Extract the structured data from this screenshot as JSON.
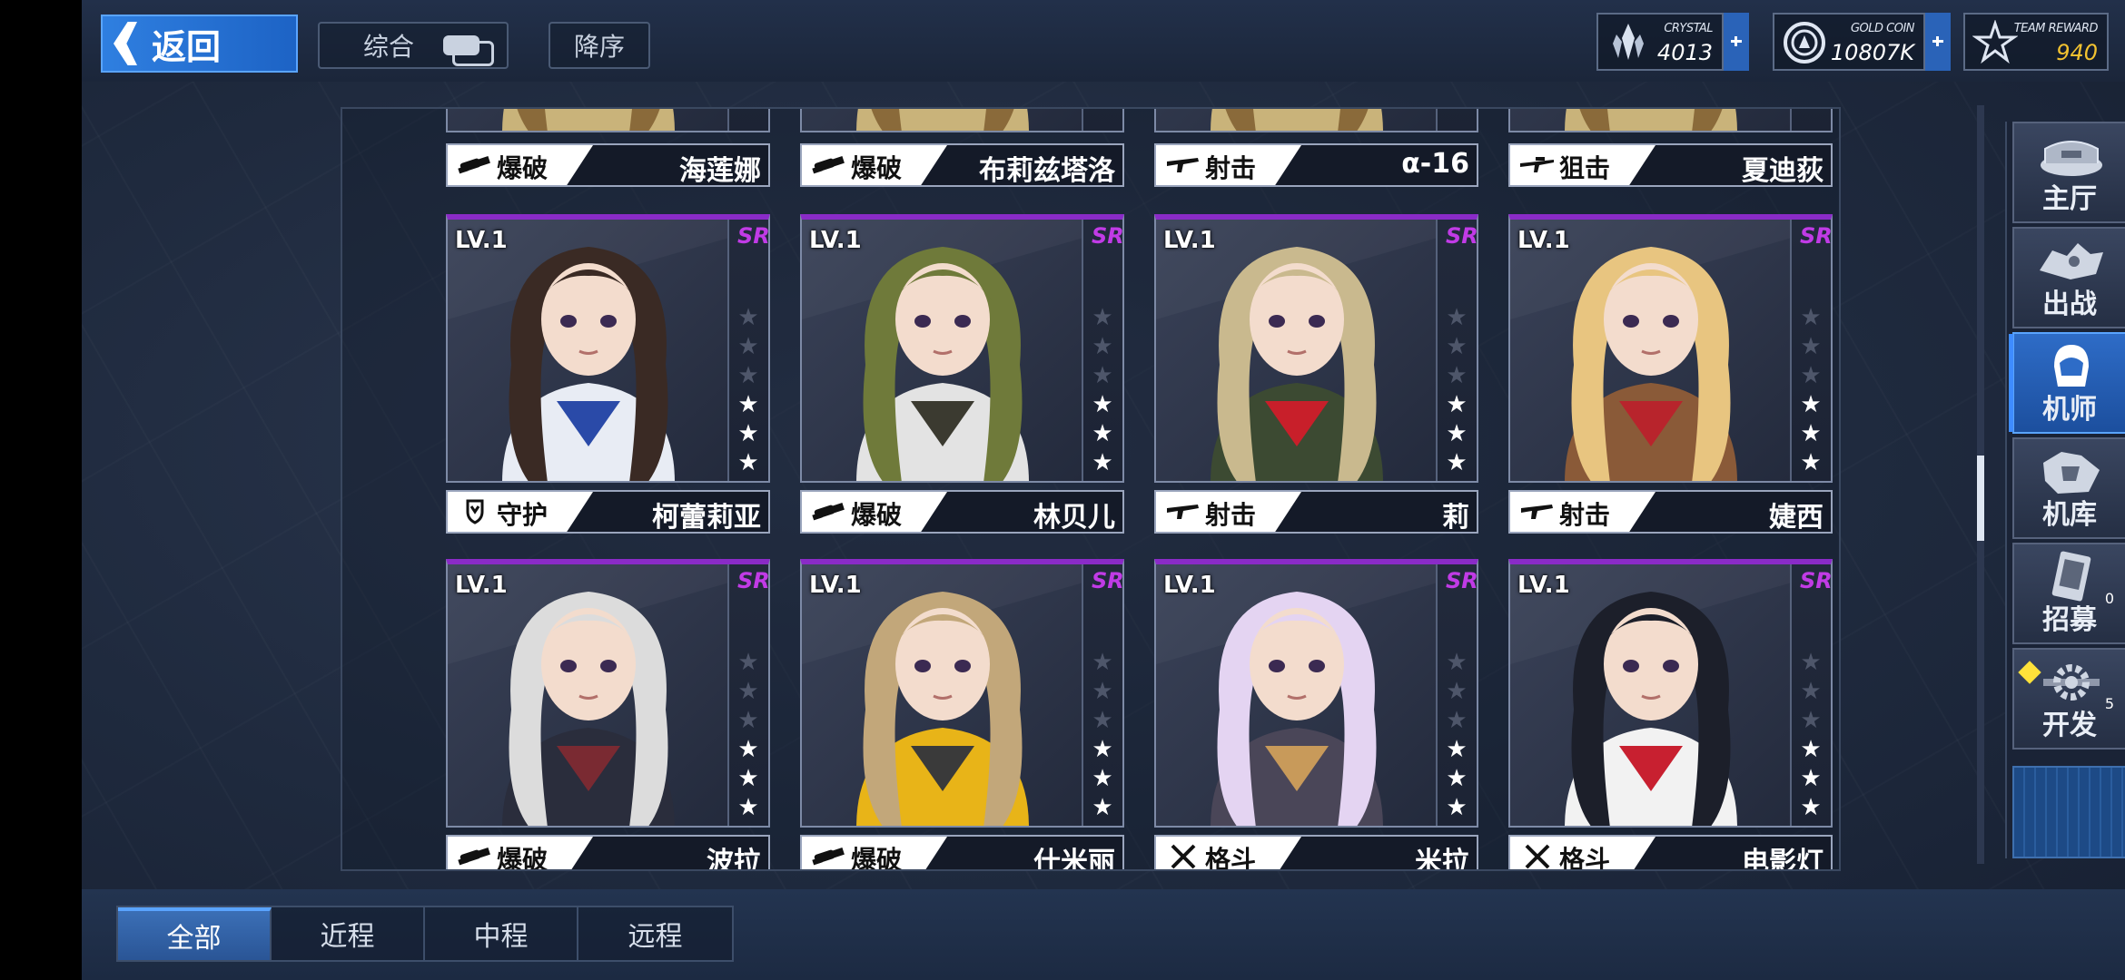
{
  "header": {
    "back_label": "返回",
    "sort_mode": "综合",
    "sort_order": "降序",
    "resources": [
      {
        "name": "CRYSTAL",
        "value": "4013",
        "value_color": "#ffffff",
        "icon": "crystal-icon"
      },
      {
        "name": "GOLD COIN",
        "value": "10807K",
        "value_color": "#ffffff",
        "icon": "gold-coin-icon"
      },
      {
        "name": "TEAM REWARD",
        "value": "940",
        "value_color": "#f2c230",
        "icon": "team-reward-star-icon"
      }
    ]
  },
  "top_row": [
    {
      "role": "爆破",
      "name": "海莲娜",
      "role_icon": "explosive-icon"
    },
    {
      "role": "爆破",
      "name": "布莉兹塔洛",
      "role_icon": "explosive-icon"
    },
    {
      "role": "射击",
      "name": "α-16",
      "role_icon": "rifle-icon"
    },
    {
      "role": "狙击",
      "name": "夏迪荻",
      "role_icon": "sniper-icon"
    }
  ],
  "cards": [
    {
      "level": "LV.1",
      "rarity": "SR",
      "stars": 3,
      "role": "守护",
      "role_icon": "shield-icon",
      "name": "柯蕾莉亚",
      "hair": "#3a2a24",
      "outfit": "#e8ecf4",
      "accent": "#2a4aa8"
    },
    {
      "level": "LV.1",
      "rarity": "SR",
      "stars": 3,
      "role": "爆破",
      "role_icon": "explosive-icon",
      "name": "林贝儿",
      "hair": "#6f7a3a",
      "outfit": "#e3e3e3",
      "accent": "#3b3a30"
    },
    {
      "level": "LV.1",
      "rarity": "SR",
      "stars": 3,
      "role": "射击",
      "role_icon": "rifle-icon",
      "name": "莉",
      "hair": "#c9b98e",
      "outfit": "#3c4a32",
      "accent": "#c81f2a"
    },
    {
      "level": "LV.1",
      "rarity": "SR",
      "stars": 3,
      "role": "射击",
      "role_icon": "rifle-icon",
      "name": "婕西",
      "hair": "#e8c580",
      "outfit": "#8a5a38",
      "accent": "#b8242c"
    },
    {
      "level": "LV.1",
      "rarity": "SR",
      "stars": 3,
      "role": "爆破",
      "role_icon": "explosive-icon",
      "name": "波拉",
      "hair": "#dcdcdc",
      "outfit": "#2a2d3c",
      "accent": "#7a2a32"
    },
    {
      "level": "LV.1",
      "rarity": "SR",
      "stars": 3,
      "role": "爆破",
      "role_icon": "explosive-icon",
      "name": "什米丽",
      "hair": "#c2a77a",
      "outfit": "#e8b418",
      "accent": "#3a3a3a"
    },
    {
      "level": "LV.1",
      "rarity": "SR",
      "stars": 3,
      "role": "格斗",
      "role_icon": "melee-icon",
      "name": "米拉",
      "hair": "#e4d4f2",
      "outfit": "#4a4658",
      "accent": "#c89a5a"
    },
    {
      "level": "LV.1",
      "rarity": "SR",
      "stars": 3,
      "role": "格斗",
      "role_icon": "melee-icon",
      "name": "电影灯",
      "hair": "#1c1f2a",
      "outfit": "#f2f2f2",
      "accent": "#c82030"
    }
  ],
  "side_nav": [
    {
      "label": "主厅",
      "icon": "main-hall-icon"
    },
    {
      "label": "出战",
      "icon": "sortie-icon"
    },
    {
      "label": "机师",
      "icon": "pilot-icon",
      "active": true
    },
    {
      "label": "机库",
      "icon": "hangar-icon"
    },
    {
      "label": "招募",
      "icon": "recruit-card-icon",
      "badge": "0"
    },
    {
      "label": "开发",
      "icon": "develop-gear-icon",
      "badge": "5",
      "alert": true
    }
  ],
  "bottom_tabs": [
    {
      "label": "全部",
      "active": true
    },
    {
      "label": "近程"
    },
    {
      "label": "中程"
    },
    {
      "label": "远程"
    }
  ]
}
